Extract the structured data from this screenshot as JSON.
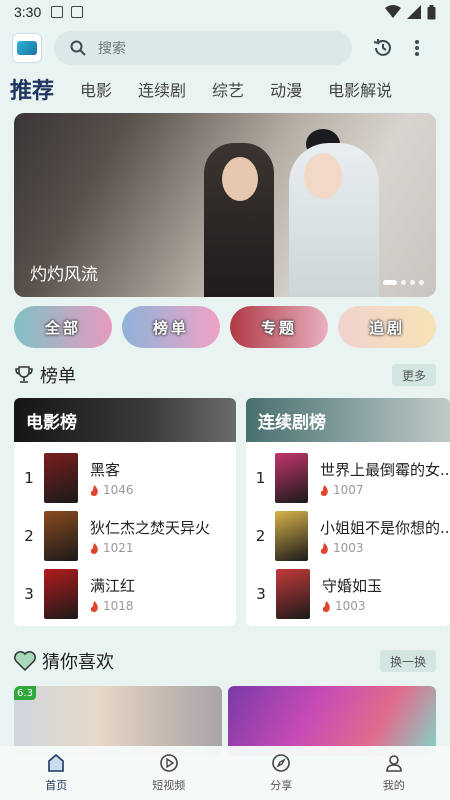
{
  "status": {
    "time": "3:30"
  },
  "search": {
    "placeholder": "搜索"
  },
  "tabs": [
    "推荐",
    "电影",
    "连续剧",
    "综艺",
    "动漫",
    "电影解说"
  ],
  "banner": {
    "title": "灼灼风流",
    "dots_count": 4
  },
  "pills": [
    "全部",
    "榜单",
    "专题",
    "追剧"
  ],
  "rank_section": {
    "title": "榜单",
    "more_label": "更多"
  },
  "movie_rank": {
    "title": "电影榜",
    "items": [
      {
        "rank": "1",
        "title": "黑客",
        "heat": "1046",
        "poster_color": "#7a1d1d"
      },
      {
        "rank": "2",
        "title": "狄仁杰之焚天异火",
        "heat": "1021",
        "poster_color": "#8a4a1f"
      },
      {
        "rank": "3",
        "title": "满江红",
        "heat": "1018",
        "poster_color": "#b31b1b"
      }
    ]
  },
  "tv_rank": {
    "title": "连续剧榜",
    "items": [
      {
        "rank": "1",
        "title": "世界上最倒霉的女...",
        "heat": "1007",
        "poster_color": "#c2356d"
      },
      {
        "rank": "2",
        "title": "小姐姐不是你想的...",
        "heat": "1003",
        "poster_color": "#d8b34a"
      },
      {
        "rank": "3",
        "title": "守婚如玉",
        "heat": "1003",
        "poster_color": "#c63a3a"
      }
    ]
  },
  "guess_section": {
    "title": "猜你喜欢",
    "refresh_label": "换一换"
  },
  "guess_items": [
    {
      "score": "6.3"
    },
    {
      "score": ""
    }
  ],
  "bottom_nav": [
    {
      "label": "首页",
      "icon": "home-icon",
      "active": true
    },
    {
      "label": "短视频",
      "icon": "play-icon",
      "active": false
    },
    {
      "label": "分享",
      "icon": "compass-icon",
      "active": false
    },
    {
      "label": "我的",
      "icon": "user-icon",
      "active": false
    }
  ],
  "colors": {
    "accent": "#1f3560",
    "background": "#e9f4f2",
    "heat": "#e0442c"
  }
}
